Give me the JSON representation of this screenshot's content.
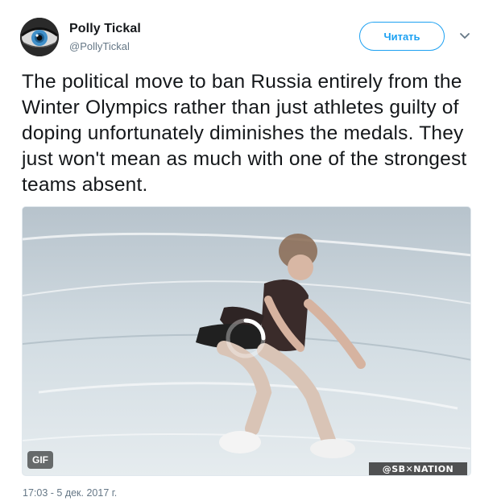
{
  "author": {
    "name": "Polly Tickal",
    "handle": "@PollyTickal"
  },
  "follow_button": {
    "label": "Читать"
  },
  "menu_icon": "chevron-down-icon",
  "tweet": {
    "text": "The political move to ban Russia entirely from the Winter Olympics rather than just athletes guilty of doping unfortunately diminishes the medals. They just won't mean as much with one of the strongest teams absent.",
    "timestamp": "17:03 - 5 дек. 2017 г."
  },
  "media": {
    "type_badge": "GIF",
    "watermark": "@SB✕NATION"
  },
  "colors": {
    "accent": "#1da1f2",
    "secondary_text": "#657786",
    "primary_text": "#14171a"
  }
}
